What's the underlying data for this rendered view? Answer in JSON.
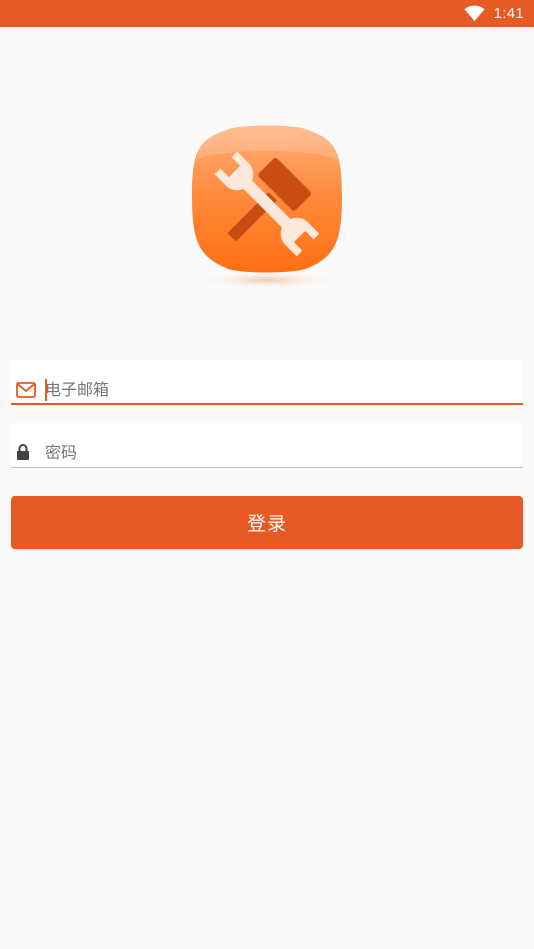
{
  "status_bar": {
    "time": "1:41",
    "wifi_icon": "wifi-icon"
  },
  "logo": {
    "icon": "hammer-wrench-icon"
  },
  "login_form": {
    "email": {
      "icon": "mail-icon",
      "placeholder": "电子邮箱",
      "value": ""
    },
    "password": {
      "icon": "lock-icon",
      "placeholder": "密码",
      "value": ""
    },
    "submit_label": "登录"
  },
  "colors": {
    "accent": "#e85a24",
    "background": "#fafafa"
  }
}
